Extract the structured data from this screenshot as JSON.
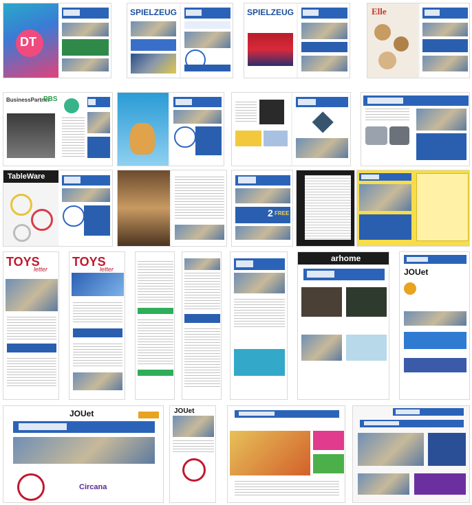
{
  "grid": {
    "tiles": [
      {
        "name": "tile-dt-magazine",
        "logo": "DT"
      },
      {
        "name": "tile-spielzeug-1",
        "logo": "SPIELZEUG"
      },
      {
        "name": "tile-spielzeug-2",
        "logo": "SPIELZEUG"
      },
      {
        "name": "tile-elle",
        "logo": "Elle"
      },
      {
        "name": "tile-business-partner",
        "logo": "BusinessPartner",
        "logo_badge": "PBS"
      },
      {
        "name": "tile-gifts-blue",
        "logo": ""
      },
      {
        "name": "tile-gifts-small",
        "logo": ""
      },
      {
        "name": "tile-gifts-kitchen",
        "logo": ""
      },
      {
        "name": "tile-tableware",
        "logo": "TableWare"
      },
      {
        "name": "tile-interior-feature",
        "logo": ""
      },
      {
        "name": "tile-gifts-free",
        "logo": "2",
        "sub": "FREE"
      },
      {
        "name": "tile-japanese-ad",
        "logo": ""
      },
      {
        "name": "tile-toys-1",
        "logo": "TOYS",
        "sub": "letter"
      },
      {
        "name": "tile-toys-2",
        "logo": "TOYS",
        "sub": "letter"
      },
      {
        "name": "tile-newsletter-1",
        "logo": ""
      },
      {
        "name": "tile-newsletter-2",
        "logo": ""
      },
      {
        "name": "tile-newsletter-3",
        "logo": ""
      },
      {
        "name": "tile-arhome",
        "logo": "arhome"
      },
      {
        "name": "tile-jouet-1",
        "logo": "JOUet"
      },
      {
        "name": "tile-jouet-wide",
        "logo": "JOUet",
        "sub": "Circana"
      },
      {
        "name": "tile-jouet-mobile",
        "logo": "JOUet"
      },
      {
        "name": "tile-web-kids",
        "logo": ""
      },
      {
        "name": "tile-web-news",
        "logo": ""
      }
    ]
  }
}
